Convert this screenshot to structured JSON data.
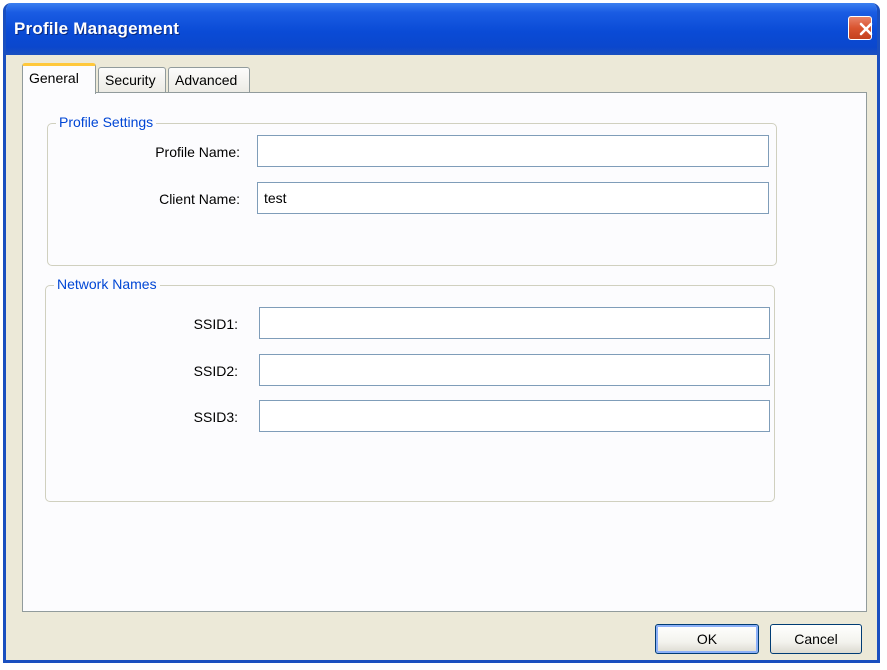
{
  "window": {
    "title": "Profile Management"
  },
  "tabs": [
    {
      "label": "General",
      "active": true
    },
    {
      "label": "Security",
      "active": false
    },
    {
      "label": "Advanced",
      "active": false
    }
  ],
  "profile_settings": {
    "legend": "Profile Settings",
    "profile_name_label": "Profile Name:",
    "profile_name_value": "",
    "client_name_label": "Client Name:",
    "client_name_value": "test"
  },
  "network_names": {
    "legend": "Network Names",
    "ssid1_label": "SSID1:",
    "ssid1_value": "",
    "ssid2_label": "SSID2:",
    "ssid2_value": "",
    "ssid3_label": "SSID3:",
    "ssid3_value": ""
  },
  "buttons": {
    "ok_label": "OK",
    "cancel_label": "Cancel"
  },
  "icons": {
    "close": "close-icon"
  },
  "colors": {
    "titlebar": "#0a4bd6",
    "close_button": "#d9542f",
    "legend_text": "#0046d5",
    "active_tab_accent": "#ffc83c",
    "dialog_background": "#ece9d8"
  }
}
